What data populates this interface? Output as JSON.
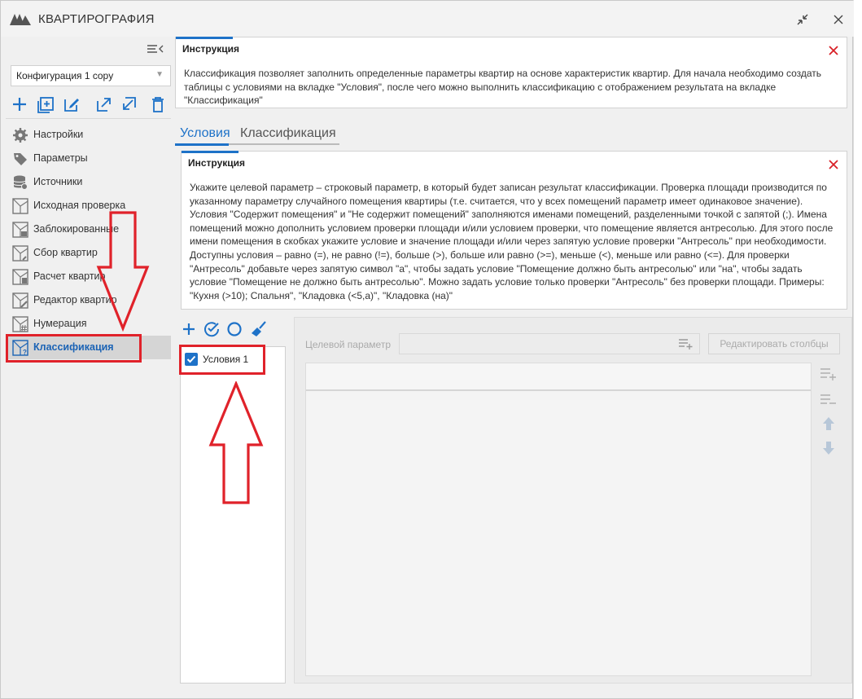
{
  "app": {
    "title": "КВАРТИРОГРАФИЯ"
  },
  "sidebar": {
    "config_selected": "Конфигурация 1 copy",
    "items": [
      {
        "label": "Настройки",
        "icon": "gear-icon"
      },
      {
        "label": "Параметры",
        "icon": "tags-icon"
      },
      {
        "label": "Источники",
        "icon": "database-icon"
      },
      {
        "label": "Исходная проверка",
        "icon": "plan-check-icon"
      },
      {
        "label": "Заблокированные",
        "icon": "plan-lock-icon"
      },
      {
        "label": "Сбор квартир",
        "icon": "plan-collect-icon"
      },
      {
        "label": "Расчет квартир",
        "icon": "plan-calc-icon"
      },
      {
        "label": "Редактор квартир",
        "icon": "plan-edit-icon"
      },
      {
        "label": "Нумерация",
        "icon": "plan-number-icon"
      },
      {
        "label": "Классификация",
        "icon": "plan-classify-icon",
        "active": true
      }
    ]
  },
  "instruction_top": {
    "title": "Инструкция",
    "text": "Классификация позволяет заполнить определенные параметры квартир на основе характеристик квартир. Для начала необходимо создать таблицы с условиями на вкладке \"Условия\", после чего можно выполнить классификацию с отображением результата на вкладке \"Классификация\""
  },
  "tabs": [
    {
      "label": "Условия",
      "active": true
    },
    {
      "label": "Классификация",
      "active": false
    }
  ],
  "instruction_conditions": {
    "title": "Инструкция",
    "text": "Укажите целевой параметр – строковый параметр, в который будет записан результат классификации. Проверка площади производится по указанному параметру случайного помещения квартиры (т.е. считается, что у всех помещений параметр имеет одинаковое значение). Условия \"Содержит помещения\" и \"Не содержит помещений\" заполняются именами помещений, разделенными точкой с запятой (;). Имена помещений можно дополнить условием проверки площади и/или условием проверки, что помещение является антресолью. Для этого после имени помещения в скобках укажите условие и значение площади и/или через запятую условие проверки \"Антресоль\" при необходимости. Доступны условия – равно (=), не равно (!=), больше (>), больше или равно (>=), меньше (<), меньше или равно (<=). Для проверки \"Антресоль\" добавьте через запятую символ \"а\", чтобы задать условие \"Помещение должно быть антресолью\" или \"на\", чтобы задать условие \"Помещение не должно быть антресолью\". Можно задать условие только проверки \"Антресоль\" без проверки площади. Примеры: \"Кухня (>10); Спальня\", \"Кладовка (<5,а)\", \"Кладовка (на)\""
  },
  "conditions": {
    "items": [
      {
        "label": "Условия 1",
        "checked": true
      }
    ]
  },
  "editor": {
    "target_label": "Целевой параметр",
    "target_value": "",
    "edit_columns_label": "Редактировать столбцы"
  },
  "colors": {
    "accent": "#1e72c8",
    "highlight": "#e0222a",
    "active_bg": "#d5d5d5"
  }
}
